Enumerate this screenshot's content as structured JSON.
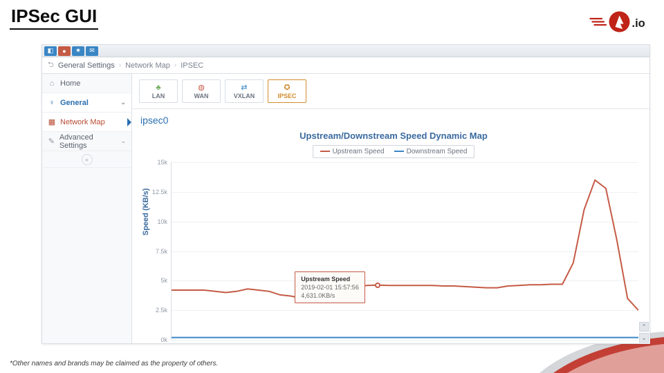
{
  "slide": {
    "title": "IPSec GUI",
    "footnote": "*Other names and brands may be claimed as the property of others."
  },
  "logo": {
    "suffix": ".io"
  },
  "header_icons": [
    "dashboard-icon",
    "globe-icon",
    "gear-icon",
    "chat-icon"
  ],
  "breadcrumb": {
    "items": [
      "General Settings",
      "Network Map",
      "IPSEC"
    ]
  },
  "sidebar": {
    "items": [
      {
        "icon": "home-icon",
        "label": "Home"
      },
      {
        "icon": "bulb-icon",
        "label": "General",
        "expandable": true,
        "active": true
      },
      {
        "icon": "chip-icon",
        "label": "Network Map",
        "current": true
      },
      {
        "icon": "wrench-icon",
        "label": "Advanced Settings",
        "expandable": true
      }
    ]
  },
  "tabs": [
    {
      "icon": "sitemap-icon",
      "label": "LAN"
    },
    {
      "icon": "globe-icon",
      "label": "WAN"
    },
    {
      "icon": "swap-icon",
      "label": "VXLAN"
    },
    {
      "icon": "link-icon",
      "label": "IPSEC",
      "active": true
    }
  ],
  "interface_label": "ipsec0",
  "chart_data": {
    "type": "line",
    "title": "Upstream/Downstream Speed Dynamic Map",
    "ylabel": "Speed (KB/s)",
    "xlabel": "",
    "ylim": [
      0,
      15000
    ],
    "yticks": [
      "0k",
      "2.5k",
      "5k",
      "7.5k",
      "10k",
      "12.5k",
      "15k"
    ],
    "legend": [
      "Upstream Speed",
      "Downstream Speed"
    ],
    "colors": {
      "upstream": "#c55a45",
      "downstream": "#3a86c5"
    },
    "series": [
      {
        "name": "Upstream Speed",
        "values": [
          4200,
          4200,
          4200,
          4200,
          4100,
          4000,
          4100,
          4300,
          4200,
          4100,
          3800,
          3700,
          3500,
          3400,
          3600,
          4000,
          4300,
          4500,
          4600,
          4631,
          4600,
          4600,
          4600,
          4600,
          4600,
          4550,
          4550,
          4500,
          4450,
          4400,
          4400,
          4550,
          4600,
          4650,
          4650,
          4700,
          4700,
          6500,
          11000,
          13500,
          12800,
          8500,
          3500,
          2500
        ]
      },
      {
        "name": "Downstream Speed",
        "values": [
          200,
          200,
          200,
          200,
          200,
          200,
          200,
          200,
          200,
          200,
          200,
          200,
          200,
          200,
          200,
          200,
          200,
          200,
          200,
          200,
          200,
          200,
          200,
          200,
          200,
          200,
          200,
          200,
          200,
          200,
          200,
          200,
          200,
          200,
          200,
          200,
          200,
          200,
          200,
          200,
          200,
          200,
          200,
          200
        ]
      }
    ],
    "tooltip": {
      "title": "Upstream Speed",
      "timestamp": "2019-02-01 15:57:56",
      "value": "4,631.0KB/s",
      "point_index": 19
    }
  }
}
